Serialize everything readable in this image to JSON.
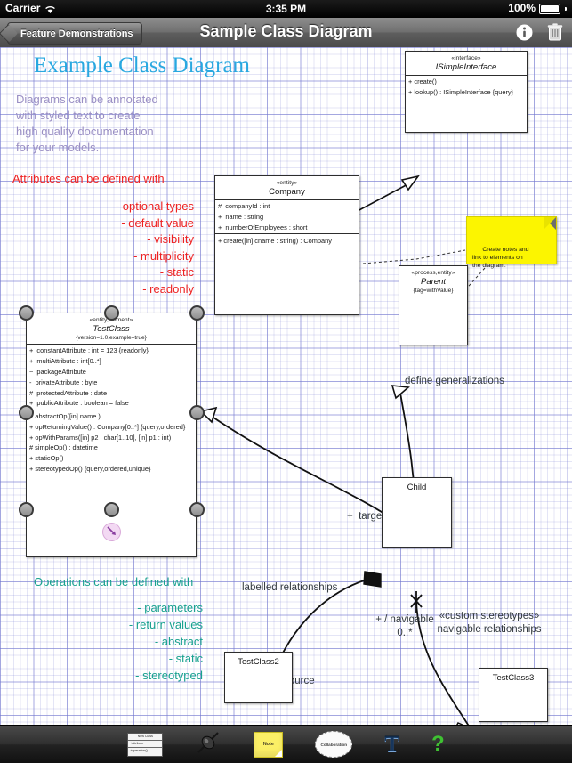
{
  "status_bar": {
    "carrier": "Carrier",
    "wifi_icon": "wifi-icon",
    "time": "3:35 PM",
    "battery_percent": "100%",
    "battery_icon": "battery-full-icon"
  },
  "nav_bar": {
    "back_label": "Feature Demonstrations",
    "title": "Sample Class Diagram",
    "info_icon": "info-icon",
    "trash_icon": "trash-icon"
  },
  "annotations": {
    "title": "Example Class Diagram",
    "purple_paragraph": "Diagrams can be annotated\nwith styled text to create\nhigh quality documentation\nfor your models.",
    "red_heading": "Attributes can be defined with",
    "red_list": "- optional types\n- default value\n- visibility\n- multiplicity\n- static\n- readonly",
    "teal_heading": "Operations can be defined with",
    "teal_list": "- parameters\n- return values\n- abstract\n- static\n- stereotyped",
    "define_generalizations": "define generalizations",
    "labelled_relationships": "labelled relationships",
    "custom_stereotypes": "«custom stereotypes»\nnavigable relationships",
    "edge_target": "+  target",
    "edge_source": "+  source",
    "edge_navigable": "+ / navigable\n0..*"
  },
  "note": {
    "text": "Create notes and\nlink to elements on\nthe diagram."
  },
  "classes": {
    "isimpleinterface": {
      "stereotype": "«interface»",
      "name": "ISimpleInterface",
      "attributes": [],
      "operations": [
        "+ create()",
        "+ lookup() : ISimpleInterface {query}"
      ]
    },
    "company": {
      "stereotype": "«entity»",
      "name": "Company",
      "attributes": [
        "#  companyId : int",
        "+  name : string",
        "+  numberOfEmployees : short"
      ],
      "operations": [
        "+ create([in] cname : string) : Company"
      ]
    },
    "parent": {
      "stereotype": "«process,entity»",
      "name": "Parent",
      "tag": "{tag=withValue}"
    },
    "testclass": {
      "stereotype": "«entity,element»",
      "name": "TestClass",
      "tag": "{version=1.0,example=true}",
      "attributes": [
        "+  constantAttribute : int = 123 {readonly}",
        "+  multiAttribute : int[0..*]",
        "~  packageAttribute",
        "-  privateAttribute : byte",
        "#  protectedAttribute : date",
        "+  publicAttribute : boolean = false"
      ],
      "operations": [
        "+ abstractOp([in] name )",
        "+ opReturningValue() : Company[0..*] {query,ordered}",
        "+ opWithParams([in] p2 : char[1..10], [in] p1 : int)",
        "# simpleOp() : datetime",
        "+ staticOp()",
        "+ stereotypedOp() {query,ordered,unique}"
      ]
    },
    "child": {
      "name": "Child"
    },
    "testclass2": {
      "name": "TestClass2"
    },
    "testclass3": {
      "name": "TestClass3"
    }
  },
  "toolbar": {
    "items": [
      {
        "name": "class-shape-tool",
        "label": "New Class",
        "attr": "+attribute",
        "op": "+operation()"
      },
      {
        "name": "pin-tool",
        "label": ""
      },
      {
        "name": "note-tool",
        "label": "Note"
      },
      {
        "name": "collaboration-tool",
        "label": "Collaboration"
      },
      {
        "name": "text-tool",
        "label": "T"
      },
      {
        "name": "help-tool",
        "label": "?"
      }
    ]
  },
  "colors": {
    "title_blue": "#29a8e0",
    "annotation_purple": "#9a8fc4",
    "annotation_red": "#ee2222",
    "annotation_teal": "#18a18f",
    "note_yellow": "#fcf500",
    "grid_blue": "#6e73cd"
  }
}
